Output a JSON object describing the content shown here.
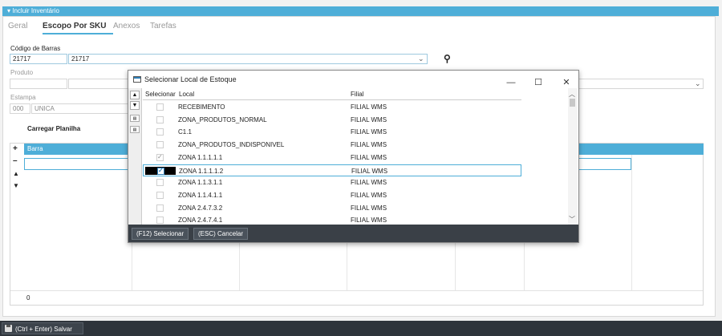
{
  "window": {
    "title": "Incluir Inventário",
    "tabs": [
      "Geral",
      "Escopo Por SKU",
      "Anexos",
      "Tarefas"
    ]
  },
  "form": {
    "barcode_label": "Código de Barras",
    "barcode_value": "21717",
    "barcode_desc": "21717",
    "product_label": "Produto",
    "stamp_label": "Estampa",
    "stamp_code": "000",
    "stamp_desc": "UNICA",
    "load_sheet_label": "Carregar Planilha"
  },
  "grid": {
    "column": "Barra",
    "footer_count": "0"
  },
  "dialog": {
    "title": "Selecionar Local de Estoque",
    "columns": [
      "Selecionar",
      "Local",
      "Filial"
    ],
    "rows": [
      {
        "local": "RECEBIMENTO",
        "filial": "FILIAL WMS",
        "checked": false
      },
      {
        "local": "ZONA_PRODUTOS_NORMAL",
        "filial": "FILIAL WMS",
        "checked": false
      },
      {
        "local": "C1.1",
        "filial": "FILIAL WMS",
        "checked": false
      },
      {
        "local": "ZONA_PRODUTOS_INDISPONIVEL",
        "filial": "FILIAL WMS",
        "checked": false
      },
      {
        "local": "ZONA 1.1.1.1.1",
        "filial": "FILIAL WMS",
        "checked": true
      },
      {
        "local": "ZONA 1.1.1.1.2",
        "filial": "FILIAL WMS",
        "checked": true,
        "selected": true
      },
      {
        "local": "ZONA 1.1.3.1.1",
        "filial": "FILIAL WMS",
        "checked": false
      },
      {
        "local": "ZONA 1.1.4.1.1",
        "filial": "FILIAL WMS",
        "checked": false
      },
      {
        "local": "ZONA 2.4.7.3.2",
        "filial": "FILIAL WMS",
        "checked": false
      },
      {
        "local": "ZONA 2.4.7.4.1",
        "filial": "FILIAL WMS",
        "checked": false
      }
    ],
    "select_button": "(F12) Selecionar",
    "cancel_button": "(ESC) Cancelar"
  },
  "footer": {
    "save_button": "(Ctrl + Enter) Salvar"
  },
  "colors": {
    "accent": "#4eaed8",
    "dark_bar": "#3a4047"
  }
}
